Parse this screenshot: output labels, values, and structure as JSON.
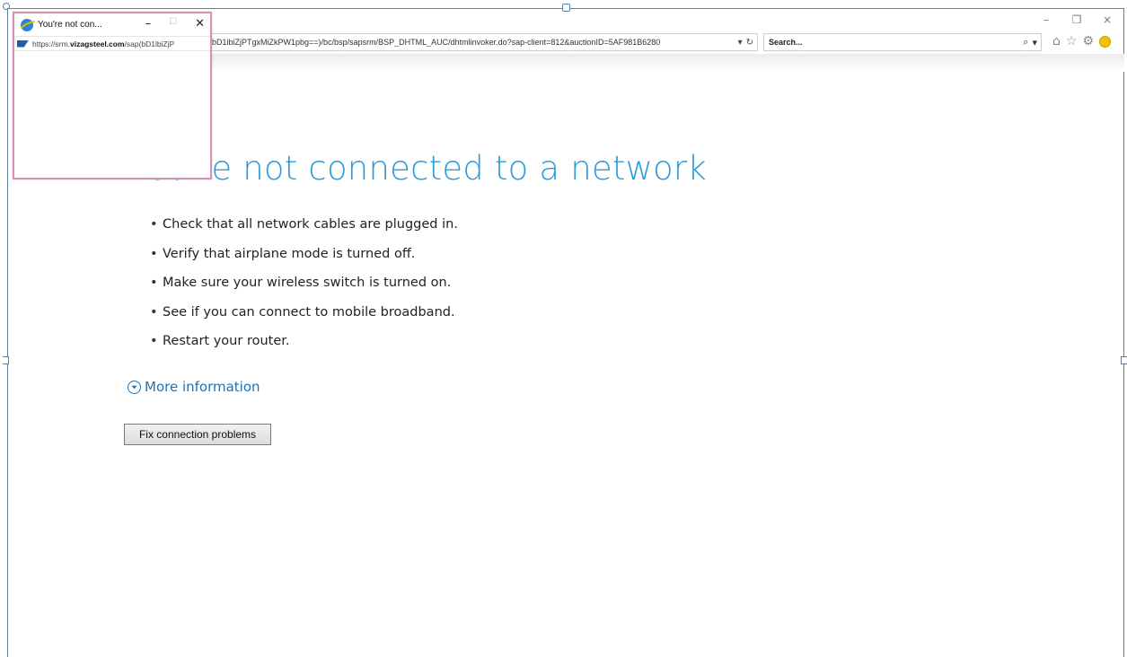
{
  "browser": {
    "address_url": "bD1lbiZjPTgxMiZkPW1pbg==)/bc/bsp/sapsrm/BSP_DHTML_AUC/dhtmlinvoker.do?sap-client=812&auctionID=5AF981B6280",
    "search_placeholder": "Search...",
    "window_controls": {
      "minimize": "–",
      "restore": "❐",
      "close": "×"
    },
    "address_buttons": {
      "dropdown": "▾",
      "refresh": "↻"
    },
    "search_icons": {
      "search": "⌕",
      "dropdown": "▾"
    },
    "toolbar_icons": {
      "home": "⌂",
      "favorites": "☆",
      "settings": "⚙"
    }
  },
  "popup": {
    "title": "You're not con...",
    "url_prefix": "https://srm.",
    "url_domain": "vizagsteel.com",
    "url_suffix": "/sap(bD1lbiZjP",
    "controls": {
      "minimize": "–",
      "maximize": "☐",
      "close": "✕"
    }
  },
  "page": {
    "headline": "You're not connected to a network",
    "tips": [
      "Check that all network cables are plugged in.",
      "Verify that airplane mode is turned off.",
      "Make sure your wireless switch is turned on.",
      "See if you can connect to mobile broadband.",
      "Restart your router."
    ],
    "more_info_label": "More information",
    "fix_button_label": "Fix connection problems"
  },
  "colors": {
    "headline": "#2b9bd8",
    "link": "#1a72b8",
    "popup_border": "#d791b4"
  }
}
